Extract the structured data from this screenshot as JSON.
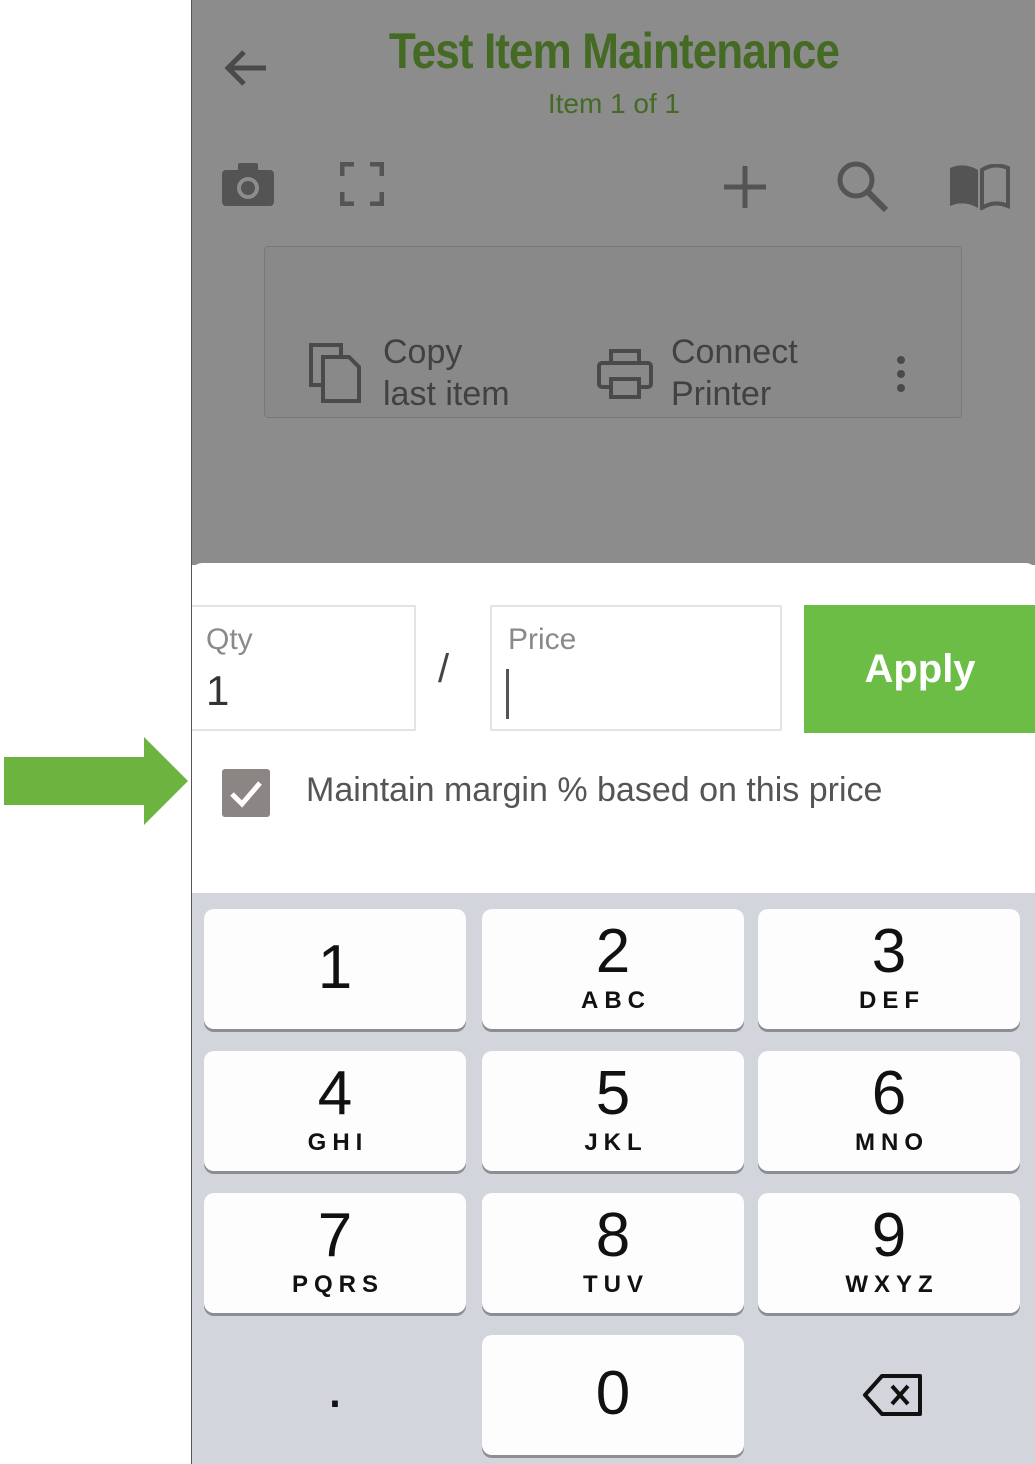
{
  "background_app": {
    "title": "Test Item Maintenance",
    "subtitle": "Item 1 of 1",
    "copy_button_label_1": "Copy",
    "copy_button_label_2": "last item",
    "printer_button_label_1": "Connect",
    "printer_button_label_2": "Printer",
    "icons": [
      "back-arrow-icon",
      "camera-icon",
      "scan-frame-icon",
      "plus-icon",
      "search-icon",
      "book-icon",
      "copy-icon",
      "printer-icon",
      "more-vert-icon"
    ]
  },
  "sheet": {
    "qty_label": "Qty",
    "qty_value": "1",
    "separator": "/",
    "price_label": "Price",
    "price_value": "",
    "apply_label": "Apply",
    "maintain_margin_checked": true,
    "maintain_margin_label": "Maintain margin % based on this price"
  },
  "keypad": {
    "keys": [
      {
        "num": "1",
        "letters": ""
      },
      {
        "num": "2",
        "letters": "ABC"
      },
      {
        "num": "3",
        "letters": "DEF"
      },
      {
        "num": "4",
        "letters": "GHI"
      },
      {
        "num": "5",
        "letters": "JKL"
      },
      {
        "num": "6",
        "letters": "MNO"
      },
      {
        "num": "7",
        "letters": "PQRS"
      },
      {
        "num": "8",
        "letters": "TUV"
      },
      {
        "num": "9",
        "letters": "WXYZ"
      },
      {
        "num": "0",
        "letters": ""
      }
    ],
    "decimal_label": ".",
    "delete_icon": "backspace-icon"
  },
  "colors": {
    "accent_green": "#6cbd45",
    "callout_arrow": "#6db33f",
    "checkbox": "#8b8584",
    "keypad_bg": "#d2d5db"
  }
}
